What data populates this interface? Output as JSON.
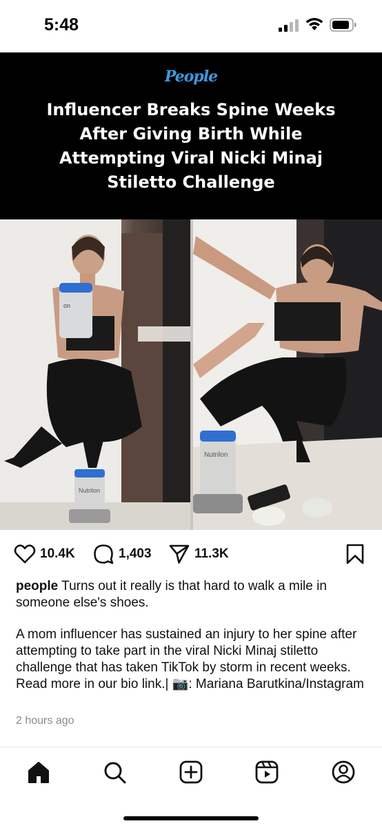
{
  "status": {
    "time": "5:48"
  },
  "post": {
    "brand": "People",
    "headline": "Influencer Breaks Spine Weeks After Giving Birth While Attempting Viral Nicki Minaj Stiletto Challenge",
    "photo_left_product": "Nutrilon",
    "photo_right_product": "Nutrilon"
  },
  "actions": {
    "likes": "10.4K",
    "comments": "1,403",
    "shares": "11.3K"
  },
  "caption": {
    "username": "people",
    "text": " Turns out it really is that hard to walk a mile in someone else's shoes.",
    "body": "A mom influencer has sustained an injury to her spine after attempting to take part in the viral Nicki Minaj stiletto challenge that has taken TikTok by storm in recent weeks. Read more in our bio link.| 📷: Mariana Barutkina/Instagram",
    "timestamp": "2 hours ago"
  },
  "nav": {
    "items": [
      "home-icon",
      "search-icon",
      "create-icon",
      "reels-icon",
      "profile-icon"
    ]
  }
}
